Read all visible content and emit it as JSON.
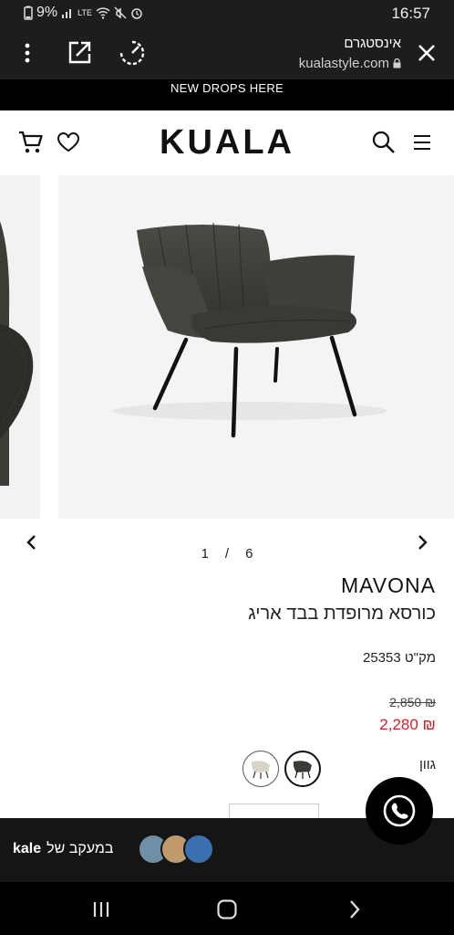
{
  "status_bar": {
    "battery": "9%",
    "network": "LTE",
    "time": "16:57",
    "icons": [
      "battery-icon",
      "signal-icon",
      "volte-icon",
      "wifi-icon",
      "mute-icon",
      "alarm-icon"
    ]
  },
  "browser_bar": {
    "title": "אינסטגרם",
    "url": "kualastyle.com",
    "icons": [
      "more-vert-icon",
      "open-external-icon",
      "speed-icon",
      "lock-icon",
      "close-icon"
    ]
  },
  "promo_banner": {
    "text": "NEW DROPS HERE"
  },
  "site_header": {
    "logo": "KUALA",
    "icons": [
      "cart-icon",
      "heart-icon",
      "search-icon",
      "menu-icon"
    ]
  },
  "gallery": {
    "current": "1",
    "separator": "/",
    "total": "6",
    "icons": [
      "chevron-left-icon",
      "chevron-right-icon"
    ]
  },
  "product": {
    "brand": "MAVONA",
    "name": "כורסא מרופדת בבד אריג",
    "sku": "מק\"ט 25353",
    "old_price": "₪ 2,850",
    "new_price": "₪ 2,280",
    "color_label": "גוון",
    "colors": [
      "#d9d3c8",
      "#3b3b36"
    ],
    "selected_color_index": 1
  },
  "follow_bar": {
    "text": "במעקב של",
    "handle": "kale"
  },
  "colors": {
    "sale": "#d0202a",
    "dark_bg": "#1d1d1d"
  }
}
